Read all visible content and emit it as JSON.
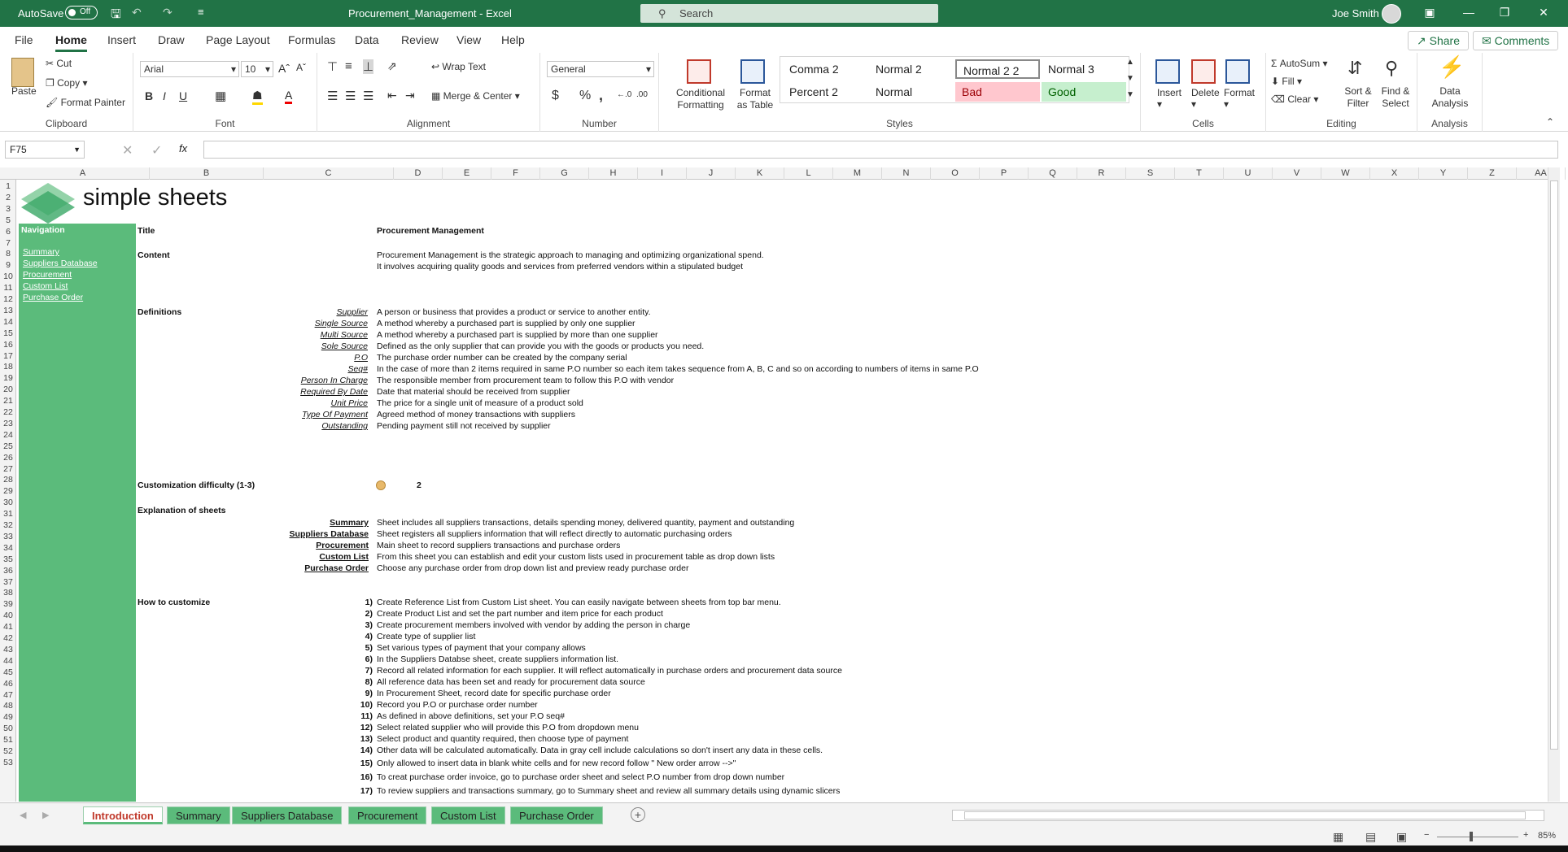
{
  "titlebar": {
    "autosave_label": "AutoSave",
    "autosave_state": "Off",
    "doc_title": "Procurement_Management  -  Excel",
    "search_placeholder": "Search",
    "user_name": "Joe Smith"
  },
  "menu": {
    "tabs": [
      "File",
      "Home",
      "Insert",
      "Draw",
      "Page Layout",
      "Formulas",
      "Data",
      "Review",
      "View",
      "Help"
    ],
    "active": "Home",
    "share_label": "Share",
    "comments_label": "Comments"
  },
  "ribbon": {
    "clipboard": {
      "paste": "Paste",
      "cut": "Cut",
      "copy": "Copy",
      "format_painter": "Format Painter",
      "label": "Clipboard"
    },
    "font": {
      "name": "Arial",
      "size": "10",
      "bold": "B",
      "italic": "I",
      "underline": "U",
      "label": "Font"
    },
    "alignment": {
      "wrap_text": "Wrap Text",
      "merge_center": "Merge & Center",
      "label": "Alignment"
    },
    "number": {
      "format": "General",
      "currency": "$",
      "percent": "%",
      "comma": ",",
      "label": "Number"
    },
    "styles": {
      "conditional": "Conditional Formatting",
      "format_as_table": "Format as Table",
      "cells": [
        "Comma 2",
        "Normal 2",
        "Normal 2 2",
        "Normal 3",
        "Percent 2",
        "Normal",
        "Bad",
        "Good"
      ],
      "label": "Styles"
    },
    "cells": {
      "insert": "Insert",
      "delete": "Delete",
      "format": "Format",
      "label": "Cells"
    },
    "editing": {
      "autosum": "AutoSum",
      "fill": "Fill",
      "clear": "Clear",
      "sort_filter": "Sort & Filter",
      "find_select": "Find & Select",
      "label": "Editing"
    },
    "analysis": {
      "data_analysis": "Data Analysis",
      "label": "Analysis"
    }
  },
  "formula_bar": {
    "name_box": "F75",
    "fx": "fx",
    "formula": ""
  },
  "columns": [
    "A",
    "B",
    "C",
    "D",
    "E",
    "F",
    "G",
    "H",
    "I",
    "J",
    "K",
    "L",
    "M",
    "N",
    "O",
    "P",
    "Q",
    "R",
    "S",
    "T",
    "U",
    "V",
    "W",
    "X",
    "Y",
    "Z",
    "AA"
  ],
  "rows": [
    "1",
    "2",
    "3",
    "5",
    "6",
    "7",
    "8",
    "9",
    "10",
    "11",
    "12",
    "13",
    "14",
    "15",
    "16",
    "17",
    "18",
    "19",
    "20",
    "21",
    "22",
    "23",
    "24",
    "25",
    "26",
    "27",
    "28",
    "29",
    "30",
    "31",
    "32",
    "33",
    "34",
    "35",
    "36",
    "37",
    "38",
    "39",
    "40",
    "41",
    "42",
    "43",
    "44",
    "45",
    "46",
    "47",
    "48",
    "49",
    "50",
    "51",
    "52",
    "53"
  ],
  "sheet": {
    "logo_text": "simple sheets",
    "nav_title": "Navigation",
    "nav_links": [
      "Summary",
      "Suppliers Database",
      "Procurement",
      "Custom List",
      "Purchase Order"
    ],
    "title_label": "Title",
    "title_value": "Procurement Management",
    "content_label": "Content",
    "content_line1": "Procurement Management is the strategic approach to managing and optimizing organizational spend.",
    "content_line2": "It involves acquiring quality goods and services from preferred vendors within a stipulated budget",
    "definitions_label": "Definitions",
    "definitions": [
      {
        "term": "Supplier",
        "text": "A person or business that provides a product or service to another entity."
      },
      {
        "term": "Single Source",
        "text": "A method whereby a purchased part is supplied by only one supplier"
      },
      {
        "term": "Multi Source",
        "text": "A method whereby a purchased part is supplied by more than one supplier"
      },
      {
        "term": "Sole Source",
        "text": "Defined as the only supplier that can provide you with the goods or products you need."
      },
      {
        "term": "P.O",
        "text": "The purchase order number can be created by the company serial"
      },
      {
        "term": "Seq#",
        "text": "In the case of more than 2 items required in same P.O number so each item takes sequence from A, B, C and so on according to numbers of items in same P.O"
      },
      {
        "term": "Person In Charge",
        "text": "The responsible member from procurement team to follow this P.O with vendor"
      },
      {
        "term": "Required By Date",
        "text": "Date that material should be received from supplier"
      },
      {
        "term": "Unit Price",
        "text": "The price for a single unit of measure of a product sold"
      },
      {
        "term": "Type Of Payment",
        "text": "Agreed method of money transactions with suppliers"
      },
      {
        "term": "Outstanding",
        "text": "Pending payment still not received by supplier"
      }
    ],
    "difficulty_label": "Customization difficulty (1-3)",
    "difficulty_value": "2",
    "explanation_label": "Explanation of sheets",
    "explanations": [
      {
        "term": "Summary",
        "text": "Sheet includes all suppliers transactions, details spending money, delivered quantity, payment and outstanding"
      },
      {
        "term": "Suppliers Database",
        "text": "Sheet registers all suppliers information that will reflect directly to automatic purchasing orders"
      },
      {
        "term": "Procurement",
        "text": "Main sheet to record suppliers transactions and purchase orders"
      },
      {
        "term": "Custom List",
        "text": "From this sheet you can establish and edit your custom lists used in procurement table as drop down lists"
      },
      {
        "term": "Purchase Order",
        "text": "Choose any purchase order from drop down list and preview ready purchase order"
      }
    ],
    "howto_label": "How to customize",
    "steps": [
      {
        "n": "1)",
        "text": "Create Reference List from Custom List sheet. You can easily navigate between sheets from top bar menu."
      },
      {
        "n": "2)",
        "text": "Create Product List and set the part number and item price for each product"
      },
      {
        "n": "3)",
        "text": "Create procurement members involved with vendor by adding the person in charge"
      },
      {
        "n": "4)",
        "text": "Create type of supplier list"
      },
      {
        "n": "5)",
        "text": "Set various types of payment that your company allows"
      },
      {
        "n": "6)",
        "text": "In the Suppliers Databse sheet, create suppliers information list."
      },
      {
        "n": "7)",
        "text": "Record all related information for each supplier. It will reflect automatically in purchase orders and procurement data source"
      },
      {
        "n": "8)",
        "text": "All reference data has been set and ready for procurement data source"
      },
      {
        "n": "9)",
        "text": "In Procurement Sheet, record date for specific purchase order"
      },
      {
        "n": "10)",
        "text": "Record you P.O or purchase order number"
      },
      {
        "n": "11)",
        "text": "As defined in above definitions, set your P.O seq#"
      },
      {
        "n": "12)",
        "text": "Select related supplier who will provide this P.O from dropdown menu"
      },
      {
        "n": "13)",
        "text": "Select product and quantity required, then choose type of payment"
      },
      {
        "n": "14)",
        "text": "Other data will be calculated automatically. Data in gray cell include calculations so don't insert any data in these cells."
      },
      {
        "n": "15)",
        "text": "Only allowed to insert data in blank white cells and for new record follow \" New order arrow -->\""
      },
      {
        "n": "16)",
        "text": "To creat purchase order invoice, go to purchase order sheet and select P.O number from drop down number"
      },
      {
        "n": "17)",
        "text": "To review suppliers and transactions summary, go to Summary sheet and review all summary details using dynamic slicers"
      }
    ]
  },
  "sheet_tabs": [
    "Introduction",
    "Summary",
    "Suppliers Database",
    "Procurement",
    "Custom List",
    "Purchase Order"
  ],
  "active_sheet": "Introduction",
  "status": {
    "zoom": "85%"
  },
  "colors": {
    "excel_green": "#217346",
    "nav_green": "#5bbb7b",
    "bad_bg": "#ffc7ce",
    "good_bg": "#c6efce"
  }
}
